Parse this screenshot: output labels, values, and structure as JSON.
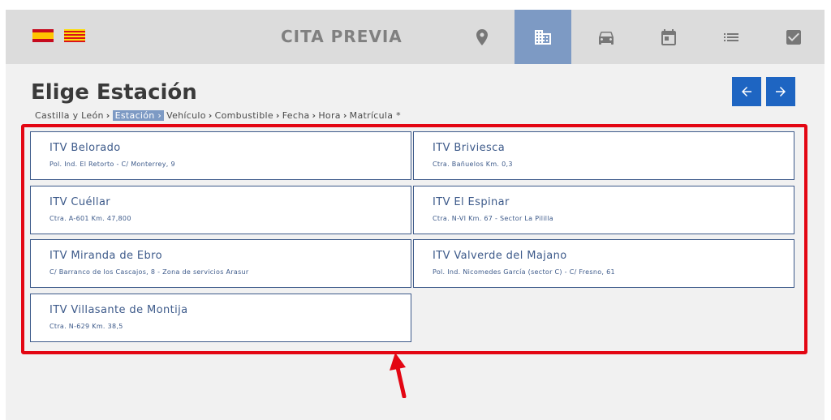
{
  "header": {
    "title": "CITA PREVIA",
    "flags": [
      "spain-flag-icon",
      "catalonia-flag-icon"
    ],
    "nav_icons": [
      "location-pin-icon",
      "building-icon",
      "car-icon",
      "calendar-icon",
      "list-icon",
      "checkbox-icon"
    ],
    "active_nav": "building-icon",
    "active_color": "#7d9ac4"
  },
  "page": {
    "title": "Elige Estación"
  },
  "breadcrumb": {
    "items": [
      "Castilla y León",
      "Estación",
      "Vehículo",
      "Combustible",
      "Fecha",
      "Hora",
      "Matrícula *"
    ],
    "separator": "›",
    "active_index": 1
  },
  "controls": {
    "prev_icon": "arrow-left-icon",
    "next_icon": "arrow-right-icon",
    "button_color": "#1e65c2"
  },
  "stations": [
    {
      "name": "ITV Belorado",
      "address": "Pol. Ind. El Retorto - C/ Monterrey, 9"
    },
    {
      "name": "ITV Briviesca",
      "address": "Ctra. Bañuelos Km. 0,3"
    },
    {
      "name": "ITV Cuéllar",
      "address": "Ctra. A-601 Km. 47,800"
    },
    {
      "name": "ITV El Espinar",
      "address": "Ctra. N-VI Km. 67 - Sector La Pililla"
    },
    {
      "name": "ITV Miranda de Ebro",
      "address": "C/ Barranco de los Cascajos, 8 - Zona de servicios Arasur"
    },
    {
      "name": "ITV Valverde del Majano",
      "address": "Pol. Ind. Nicomedes García (sector C) - C/ Fresno, 61"
    },
    {
      "name": "ITV Villasante de Montija",
      "address": "Ctra. N-629 Km. 38,5"
    }
  ],
  "annotation": {
    "highlight_color": "#e30613",
    "arrow_icon": "red-arrow-up-icon"
  }
}
